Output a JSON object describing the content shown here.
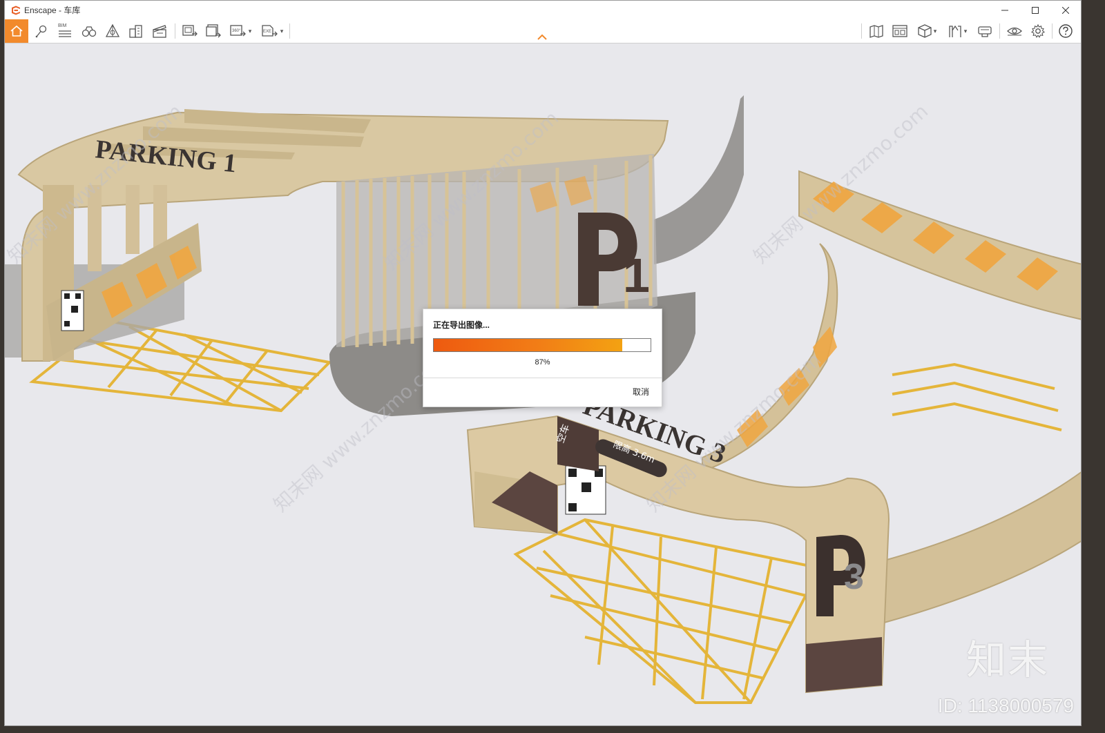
{
  "window": {
    "title": "Enscape - 车库",
    "logo_color": "#e8612a"
  },
  "toolbar": {
    "accent_color": "#f28a2c",
    "bim_label": "BIM",
    "left_tools": [
      "home-icon",
      "location-pin-icon",
      "bim-icon",
      "binoculars-icon",
      "perspective-icon",
      "buildings-icon",
      "clapperboard-icon"
    ],
    "export_tools": [
      "render-image-icon",
      "batch-render-icon",
      "panorama-360-icon",
      "exe-export-icon"
    ],
    "panorama_label": "360°",
    "exe_label": "EXE",
    "right_tools": [
      "map-icon",
      "asset-library-icon",
      "cube-icon",
      "walkthrough-icon",
      "vr-headset-icon",
      "eye-icon",
      "gear-icon",
      "help-icon"
    ]
  },
  "dialog": {
    "title": "正在导出图像...",
    "progress_value": 0.87,
    "progress_label": "87%",
    "cancel_label": "取消"
  },
  "scene": {
    "sign_parking1": "PARKING 1",
    "sign_parking3": "PARKING 3",
    "sign_p1": "P1",
    "sign_p3": "P3",
    "height_limit": "限高 3.6m",
    "sign_vacancy": "空车"
  },
  "watermark": {
    "logo_text": "知末",
    "id_text": "ID: 1138000579",
    "site_text": "知末网 www.znzmo.com"
  }
}
